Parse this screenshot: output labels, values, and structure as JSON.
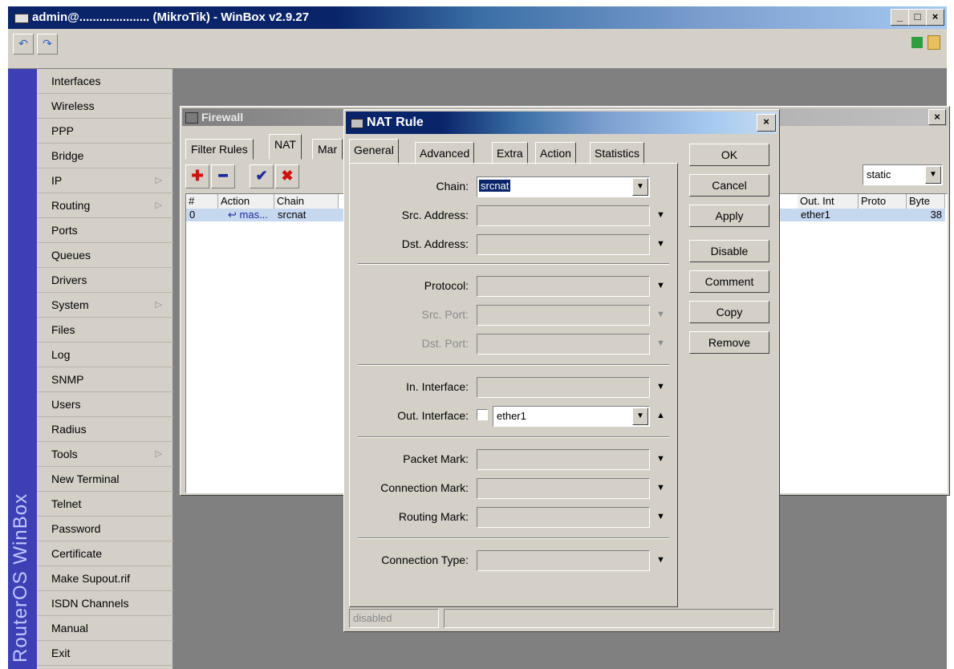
{
  "window": {
    "title": "admin@..................... (MikroTik) - WinBox v2.9.27",
    "controls": [
      "_",
      "□",
      "×"
    ]
  },
  "toolbar": {
    "undo_icon": "undo-icon",
    "redo_icon": "redo-icon"
  },
  "sidebar": {
    "brand": "RouterOS WinBox",
    "items": [
      {
        "label": "Interfaces",
        "arrow": ""
      },
      {
        "label": "Wireless",
        "arrow": ""
      },
      {
        "label": "PPP",
        "arrow": ""
      },
      {
        "label": "Bridge",
        "arrow": ""
      },
      {
        "label": "IP",
        "arrow": "▷"
      },
      {
        "label": "Routing",
        "arrow": "▷"
      },
      {
        "label": "Ports",
        "arrow": ""
      },
      {
        "label": "Queues",
        "arrow": ""
      },
      {
        "label": "Drivers",
        "arrow": ""
      },
      {
        "label": "System",
        "arrow": "▷"
      },
      {
        "label": "Files",
        "arrow": ""
      },
      {
        "label": "Log",
        "arrow": ""
      },
      {
        "label": "SNMP",
        "arrow": ""
      },
      {
        "label": "Users",
        "arrow": ""
      },
      {
        "label": "Radius",
        "arrow": ""
      },
      {
        "label": "Tools",
        "arrow": "▷"
      },
      {
        "label": "New Terminal",
        "arrow": ""
      },
      {
        "label": "Telnet",
        "arrow": ""
      },
      {
        "label": "Password",
        "arrow": ""
      },
      {
        "label": "Certificate",
        "arrow": ""
      },
      {
        "label": "Make Supout.rif",
        "arrow": ""
      },
      {
        "label": "ISDN Channels",
        "arrow": ""
      },
      {
        "label": "Manual",
        "arrow": ""
      },
      {
        "label": "Exit",
        "arrow": ""
      }
    ]
  },
  "firewall": {
    "title": "Firewall",
    "tabs": [
      "Filter Rules",
      "NAT",
      "Mar"
    ],
    "filter_value": "static",
    "columns_left": [
      "#",
      "Action",
      "Chain"
    ],
    "columns_right": [
      "Out. Int",
      "Proto",
      "Byte"
    ],
    "row": {
      "num": "0",
      "action": "masquerade",
      "action_display": "↩ mas...",
      "chain": "srcnat",
      "out_int": "ether1",
      "bytes": "38"
    }
  },
  "nat_rule": {
    "title": "NAT Rule",
    "tabs": [
      "General",
      "Advanced",
      "Extra",
      "Action",
      "Statistics"
    ],
    "fields": {
      "chain": {
        "label": "Chain:",
        "value": "srcnat"
      },
      "src_address": {
        "label": "Src. Address:"
      },
      "dst_address": {
        "label": "Dst. Address:"
      },
      "protocol": {
        "label": "Protocol:"
      },
      "src_port": {
        "label": "Src. Port:"
      },
      "dst_port": {
        "label": "Dst. Port:"
      },
      "in_interface": {
        "label": "In. Interface:"
      },
      "out_interface": {
        "label": "Out. Interface:",
        "value": "ether1"
      },
      "packet_mark": {
        "label": "Packet Mark:"
      },
      "connection_mark": {
        "label": "Connection Mark:"
      },
      "routing_mark": {
        "label": "Routing Mark:"
      },
      "connection_type": {
        "label": "Connection Type:"
      }
    },
    "buttons": [
      "OK",
      "Cancel",
      "Apply",
      "Disable",
      "Comment",
      "Copy",
      "Remove"
    ],
    "status": "disabled"
  }
}
